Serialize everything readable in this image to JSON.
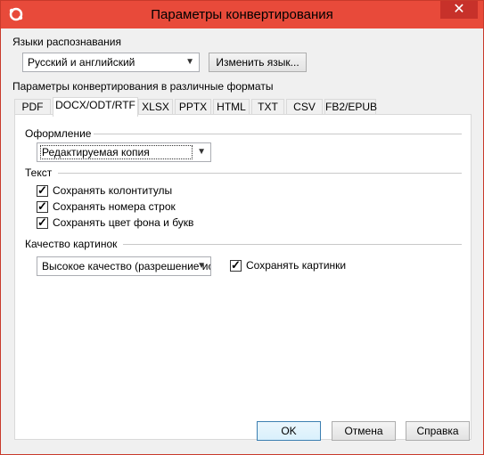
{
  "window": {
    "title": "Параметры конвертирования",
    "close_glyph": "✕",
    "titlebar_color": "#e84a3a"
  },
  "languages": {
    "label": "Языки распознавания",
    "selected": "Русский и английский",
    "change_button": "Изменить язык..."
  },
  "format_section_label": "Параметры конвертирования в различные форматы",
  "tabs": [
    {
      "label": "PDF"
    },
    {
      "label": "DOCX/ODT/RTF"
    },
    {
      "label": "XLSX"
    },
    {
      "label": "PPTX"
    },
    {
      "label": "HTML"
    },
    {
      "label": "TXT"
    },
    {
      "label": "CSV"
    },
    {
      "label": "FB2/EPUB"
    }
  ],
  "layout_group": {
    "title": "Оформление",
    "selected": "Редактируемая копия"
  },
  "text_group": {
    "title": "Текст",
    "options": [
      {
        "label": "Сохранять колонтитулы",
        "checked": true
      },
      {
        "label": "Сохранять номера строк",
        "checked": true
      },
      {
        "label": "Сохранять цвет фона и букв",
        "checked": true
      }
    ]
  },
  "images_group": {
    "title": "Качество картинок",
    "selected": "Высокое качество (разрешение ис",
    "keep_images": {
      "label": "Сохранять картинки",
      "checked": true
    }
  },
  "footer": {
    "ok": "OK",
    "cancel": "Отмена",
    "help": "Справка"
  },
  "icons": {
    "app": "abbyy-app-icon",
    "dropdown": "chevron-down-icon"
  }
}
